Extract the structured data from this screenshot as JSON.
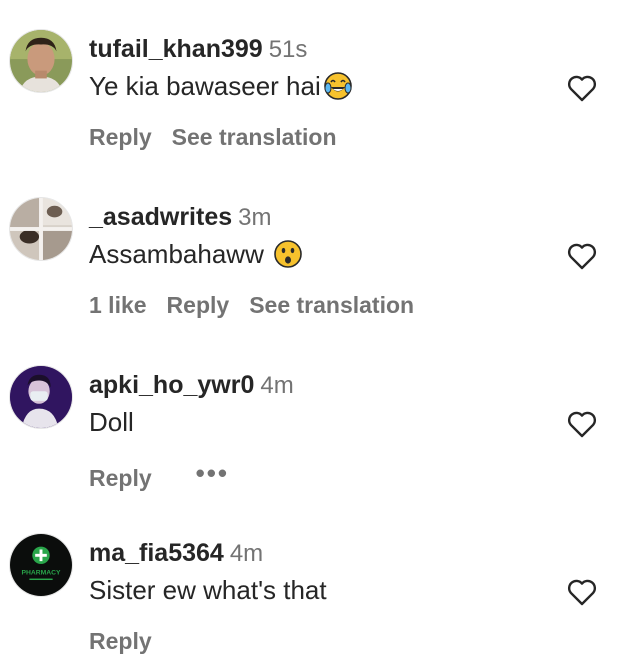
{
  "comments": [
    {
      "username": "tufail_khan399",
      "time": "51s",
      "text": "Ye kia bawaseer hai",
      "emoji": "face-with-tears-of-joy",
      "likes": "",
      "reply": "Reply",
      "translate": "See translation",
      "avatar": "man-portrait"
    },
    {
      "username": "_asadwrites",
      "time": "3m",
      "text": "Assambahaww ",
      "emoji": "hushed-face",
      "likes": "1 like",
      "reply": "Reply",
      "translate": "See translation",
      "avatar": "photo-collage"
    },
    {
      "username": "apki_ho_ywr0",
      "time": "4m",
      "text": "Doll",
      "emoji": "",
      "likes": "",
      "reply": "Reply",
      "translate": "",
      "more": "•••",
      "avatar": "masked-person-purple"
    },
    {
      "username": "ma_fia5364",
      "time": "4m",
      "text": "Sister ew what's that",
      "emoji": "",
      "likes": "",
      "reply": "Reply",
      "translate": "",
      "avatar": "pharmacy-logo",
      "avatar_text": "PHARMACY"
    }
  ],
  "colors": {
    "text": "#262626",
    "secondary": "#737373",
    "background": "#ffffff"
  },
  "icons": {
    "like": "heart-outline-icon",
    "more": "more-options-icon"
  }
}
